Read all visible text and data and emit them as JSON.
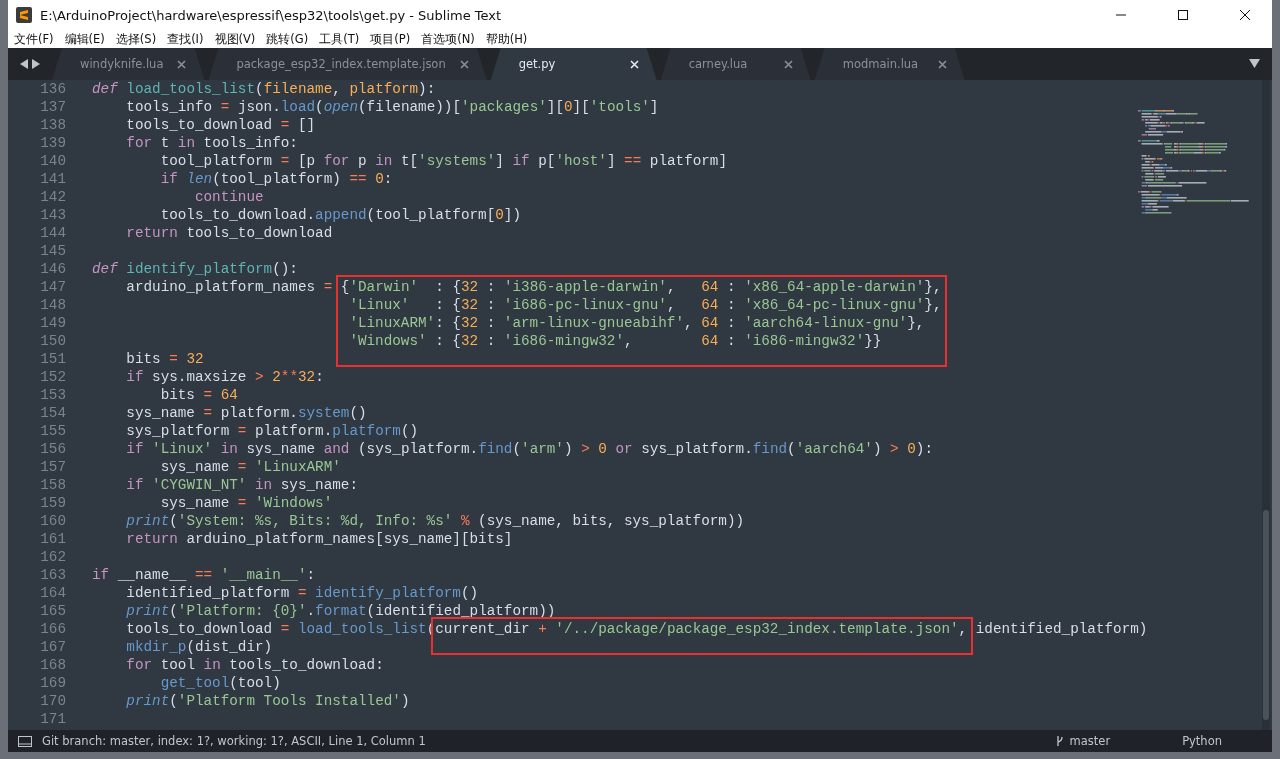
{
  "window": {
    "title": "E:\\ArduinoProject\\hardware\\espressif\\esp32\\tools\\get.py - Sublime Text"
  },
  "menu": [
    "文件(F)",
    "编辑(E)",
    "选择(S)",
    "查找(I)",
    "视图(V)",
    "跳转(G)",
    "工具(T)",
    "项目(P)",
    "首选项(N)",
    "帮助(H)"
  ],
  "tabs": [
    {
      "label": "windyknife.lua",
      "selected": false
    },
    {
      "label": "package_esp32_index.template.json",
      "selected": false
    },
    {
      "label": "get.py",
      "selected": true
    },
    {
      "label": "carney.lua",
      "selected": false
    },
    {
      "label": "modmain.lua",
      "selected": false
    }
  ],
  "editor": {
    "lines": [
      {
        "number": "136",
        "code": [
          {
            "kind": "def",
            "text": "def"
          },
          {
            "kind": "fn",
            "text": " load_tools_list"
          },
          {
            "kind": "text",
            "text": "("
          },
          {
            "kind": "param",
            "text": "filename"
          },
          {
            "kind": "text",
            "text": ", "
          },
          {
            "kind": "param",
            "text": "platform"
          },
          {
            "kind": "text",
            "text": "):"
          }
        ]
      },
      {
        "number": "137",
        "code": [
          {
            "kind": "text",
            "text": "    tools_info "
          },
          {
            "kind": "op",
            "text": "="
          },
          {
            "kind": "text",
            "text": " json."
          },
          {
            "kind": "call",
            "text": "load"
          },
          {
            "kind": "text",
            "text": "("
          },
          {
            "kind": "builtin",
            "text": "open"
          },
          {
            "kind": "text",
            "text": "(filename))["
          },
          {
            "kind": "str",
            "text": "'packages'"
          },
          {
            "kind": "text",
            "text": "]["
          },
          {
            "kind": "num",
            "text": "0"
          },
          {
            "kind": "text",
            "text": "]["
          },
          {
            "kind": "str",
            "text": "'tools'"
          },
          {
            "kind": "text",
            "text": "]"
          }
        ]
      },
      {
        "number": "138",
        "code": [
          {
            "kind": "text",
            "text": "    tools_to_download "
          },
          {
            "kind": "op",
            "text": "="
          },
          {
            "kind": "text",
            "text": " []"
          }
        ]
      },
      {
        "number": "139",
        "code": [
          {
            "kind": "kw",
            "text": "    for"
          },
          {
            "kind": "text",
            "text": " t "
          },
          {
            "kind": "kw",
            "text": "in"
          },
          {
            "kind": "text",
            "text": " tools_info:"
          }
        ]
      },
      {
        "number": "140",
        "code": [
          {
            "kind": "text",
            "text": "        tool_platform "
          },
          {
            "kind": "op",
            "text": "="
          },
          {
            "kind": "text",
            "text": " [p "
          },
          {
            "kind": "kw",
            "text": "for"
          },
          {
            "kind": "text",
            "text": " p "
          },
          {
            "kind": "kw",
            "text": "in"
          },
          {
            "kind": "text",
            "text": " t["
          },
          {
            "kind": "str",
            "text": "'systems'"
          },
          {
            "kind": "text",
            "text": "] "
          },
          {
            "kind": "kw",
            "text": "if"
          },
          {
            "kind": "text",
            "text": " p["
          },
          {
            "kind": "str",
            "text": "'host'"
          },
          {
            "kind": "text",
            "text": "] "
          },
          {
            "kind": "op",
            "text": "=="
          },
          {
            "kind": "text",
            "text": " platform]"
          }
        ]
      },
      {
        "number": "141",
        "code": [
          {
            "kind": "kw",
            "text": "        if"
          },
          {
            "kind": "builtin",
            "text": " len"
          },
          {
            "kind": "text",
            "text": "(tool_platform) "
          },
          {
            "kind": "op",
            "text": "=="
          },
          {
            "kind": "num",
            "text": " 0"
          },
          {
            "kind": "text",
            "text": ":"
          }
        ]
      },
      {
        "number": "142",
        "code": [
          {
            "kind": "kw",
            "text": "            continue"
          }
        ]
      },
      {
        "number": "143",
        "code": [
          {
            "kind": "text",
            "text": "        tools_to_download."
          },
          {
            "kind": "call",
            "text": "append"
          },
          {
            "kind": "text",
            "text": "(tool_platform["
          },
          {
            "kind": "num",
            "text": "0"
          },
          {
            "kind": "text",
            "text": "])"
          }
        ]
      },
      {
        "number": "144",
        "code": [
          {
            "kind": "kw",
            "text": "    return"
          },
          {
            "kind": "text",
            "text": " tools_to_download"
          }
        ]
      },
      {
        "number": "145"
      },
      {
        "number": "146",
        "code": [
          {
            "kind": "def",
            "text": "def"
          },
          {
            "kind": "fn",
            "text": " identify_platform"
          },
          {
            "kind": "text",
            "text": "():"
          }
        ]
      },
      {
        "number": "147",
        "code": [
          {
            "kind": "text",
            "text": "    arduino_platform_names "
          },
          {
            "kind": "op",
            "text": "="
          }
        ],
        "marked": [
          {
            "kind": "text",
            "text": " {"
          },
          {
            "kind": "str",
            "text": "'Darwin'"
          },
          {
            "kind": "text",
            "text": "  : {"
          },
          {
            "kind": "num",
            "text": "32"
          },
          {
            "kind": "text",
            "text": " : "
          },
          {
            "kind": "str",
            "text": "'i386-apple-darwin'"
          },
          {
            "kind": "text",
            "text": ",   "
          },
          {
            "kind": "num",
            "text": "64"
          },
          {
            "kind": "text",
            "text": " : "
          },
          {
            "kind": "str",
            "text": "'x86_64-apple-darwin'"
          },
          {
            "kind": "text",
            "text": "},"
          }
        ]
      },
      {
        "number": "148",
        "marked": [
          {
            "kind": "str",
            "text": "                              'Linux'"
          },
          {
            "kind": "text",
            "text": "   : {"
          },
          {
            "kind": "num",
            "text": "32"
          },
          {
            "kind": "text",
            "text": " : "
          },
          {
            "kind": "str",
            "text": "'i686-pc-linux-gnu'"
          },
          {
            "kind": "text",
            "text": ",   "
          },
          {
            "kind": "num",
            "text": "64"
          },
          {
            "kind": "text",
            "text": " : "
          },
          {
            "kind": "str",
            "text": "'x86_64-pc-linux-gnu'"
          },
          {
            "kind": "text",
            "text": "},"
          }
        ]
      },
      {
        "number": "149",
        "marked": [
          {
            "kind": "str",
            "text": "                              'LinuxARM'"
          },
          {
            "kind": "text",
            "text": ": {"
          },
          {
            "kind": "num",
            "text": "32"
          },
          {
            "kind": "text",
            "text": " : "
          },
          {
            "kind": "str",
            "text": "'arm-linux-gnueabihf'"
          },
          {
            "kind": "text",
            "text": ", "
          },
          {
            "kind": "num",
            "text": "64"
          },
          {
            "kind": "text",
            "text": " : "
          },
          {
            "kind": "str",
            "text": "'aarch64-linux-gnu'"
          },
          {
            "kind": "text",
            "text": "},"
          }
        ]
      },
      {
        "number": "150",
        "marked": [
          {
            "kind": "str",
            "text": "                              'Windows'"
          },
          {
            "kind": "text",
            "text": " : {"
          },
          {
            "kind": "num",
            "text": "32"
          },
          {
            "kind": "text",
            "text": " : "
          },
          {
            "kind": "str",
            "text": "'i686-mingw32'"
          },
          {
            "kind": "text",
            "text": ",        "
          },
          {
            "kind": "num",
            "text": "64"
          },
          {
            "kind": "text",
            "text": " : "
          },
          {
            "kind": "str",
            "text": "'i686-mingw32'"
          },
          {
            "kind": "text",
            "text": "}}"
          }
        ]
      },
      {
        "number": "151",
        "code": [
          {
            "kind": "text",
            "text": "    bits "
          },
          {
            "kind": "op",
            "text": "="
          },
          {
            "kind": "num",
            "text": " 32"
          }
        ]
      },
      {
        "number": "152",
        "code": [
          {
            "kind": "kw",
            "text": "    if"
          },
          {
            "kind": "text",
            "text": " sys.maxsize "
          },
          {
            "kind": "op",
            "text": ">"
          },
          {
            "kind": "num",
            "text": " 2"
          },
          {
            "kind": "op",
            "text": "**"
          },
          {
            "kind": "num",
            "text": "32"
          },
          {
            "kind": "text",
            "text": ":"
          }
        ]
      },
      {
        "number": "153",
        "code": [
          {
            "kind": "text",
            "text": "        bits "
          },
          {
            "kind": "op",
            "text": "="
          },
          {
            "kind": "num",
            "text": " 64"
          }
        ]
      },
      {
        "number": "154",
        "code": [
          {
            "kind": "text",
            "text": "    sys_name "
          },
          {
            "kind": "op",
            "text": "="
          },
          {
            "kind": "text",
            "text": " platform."
          },
          {
            "kind": "call",
            "text": "system"
          },
          {
            "kind": "text",
            "text": "()"
          }
        ]
      },
      {
        "number": "155",
        "code": [
          {
            "kind": "text",
            "text": "    sys_platform "
          },
          {
            "kind": "op",
            "text": "="
          },
          {
            "kind": "text",
            "text": " platform."
          },
          {
            "kind": "call",
            "text": "platform"
          },
          {
            "kind": "text",
            "text": "()"
          }
        ]
      },
      {
        "number": "156",
        "code": [
          {
            "kind": "kw",
            "text": "    if"
          },
          {
            "kind": "str",
            "text": " 'Linux'"
          },
          {
            "kind": "kw",
            "text": " in"
          },
          {
            "kind": "text",
            "text": " sys_name "
          },
          {
            "kind": "kw",
            "text": "and"
          },
          {
            "kind": "text",
            "text": " (sys_platform."
          },
          {
            "kind": "call",
            "text": "find"
          },
          {
            "kind": "text",
            "text": "("
          },
          {
            "kind": "str",
            "text": "'arm'"
          },
          {
            "kind": "text",
            "text": ") "
          },
          {
            "kind": "op",
            "text": ">"
          },
          {
            "kind": "num",
            "text": " 0"
          },
          {
            "kind": "kw",
            "text": " or"
          },
          {
            "kind": "text",
            "text": " sys_platform."
          },
          {
            "kind": "call",
            "text": "find"
          },
          {
            "kind": "text",
            "text": "("
          },
          {
            "kind": "str",
            "text": "'aarch64'"
          },
          {
            "kind": "text",
            "text": ") "
          },
          {
            "kind": "op",
            "text": ">"
          },
          {
            "kind": "num",
            "text": " 0"
          },
          {
            "kind": "text",
            "text": "):"
          }
        ]
      },
      {
        "number": "157",
        "code": [
          {
            "kind": "text",
            "text": "        sys_name "
          },
          {
            "kind": "op",
            "text": "="
          },
          {
            "kind": "str",
            "text": " 'LinuxARM'"
          }
        ]
      },
      {
        "number": "158",
        "code": [
          {
            "kind": "kw",
            "text": "    if"
          },
          {
            "kind": "str",
            "text": " 'CYGWIN_NT'"
          },
          {
            "kind": "kw",
            "text": " in"
          },
          {
            "kind": "text",
            "text": " sys_name:"
          }
        ]
      },
      {
        "number": "159",
        "code": [
          {
            "kind": "text",
            "text": "        sys_name "
          },
          {
            "kind": "op",
            "text": "="
          },
          {
            "kind": "str",
            "text": " 'Windows'"
          }
        ]
      },
      {
        "number": "160",
        "code": [
          {
            "kind": "builtin",
            "text": "    print"
          },
          {
            "kind": "text",
            "text": "("
          },
          {
            "kind": "str",
            "text": "'System: %s, Bits: %d, Info: %s'"
          },
          {
            "kind": "op",
            "text": " %"
          },
          {
            "kind": "text",
            "text": " (sys_name, bits, sys_platform))"
          }
        ]
      },
      {
        "number": "161",
        "code": [
          {
            "kind": "kw",
            "text": "    return"
          },
          {
            "kind": "text",
            "text": " arduino_platform_names[sys_name][bits]"
          }
        ]
      },
      {
        "number": "162"
      },
      {
        "number": "163",
        "code": [
          {
            "kind": "kw",
            "text": "if"
          },
          {
            "kind": "text",
            "text": " __name__ "
          },
          {
            "kind": "op",
            "text": "=="
          },
          {
            "kind": "str",
            "text": " '__main__'"
          },
          {
            "kind": "text",
            "text": ":"
          }
        ]
      },
      {
        "number": "164",
        "code": [
          {
            "kind": "text",
            "text": "    identified_platform "
          },
          {
            "kind": "op",
            "text": "="
          },
          {
            "kind": "call",
            "text": " identify_platform"
          },
          {
            "kind": "text",
            "text": "()"
          }
        ]
      },
      {
        "number": "165",
        "code": [
          {
            "kind": "builtin",
            "text": "    print"
          },
          {
            "kind": "text",
            "text": "("
          },
          {
            "kind": "str",
            "text": "'Platform: {0}'"
          },
          {
            "kind": "text",
            "text": "."
          },
          {
            "kind": "call",
            "text": "format"
          },
          {
            "kind": "text",
            "text": "(identified_platform))"
          }
        ]
      },
      {
        "number": "166",
        "code": [
          {
            "kind": "text",
            "text": "    tools_to_download "
          },
          {
            "kind": "op",
            "text": "="
          },
          {
            "kind": "call",
            "text": " load_tools_list"
          },
          {
            "kind": "text",
            "text": "("
          }
        ],
        "marked": [
          {
            "kind": "text",
            "text": "current_dir "
          },
          {
            "kind": "op",
            "text": "+"
          },
          {
            "kind": "str",
            "text": " '/../package/package_esp32_index.template.json'"
          },
          {
            "kind": "text",
            "text": ","
          }
        ],
        "rest": [
          {
            "kind": "text",
            "text": " identified_platform)"
          }
        ]
      },
      {
        "number": "167",
        "code": [
          {
            "kind": "call",
            "text": "    mkdir_p"
          },
          {
            "kind": "text",
            "text": "(dist_dir)"
          }
        ]
      },
      {
        "number": "168",
        "code": [
          {
            "kind": "kw",
            "text": "    for"
          },
          {
            "kind": "text",
            "text": " tool "
          },
          {
            "kind": "kw",
            "text": "in"
          },
          {
            "kind": "text",
            "text": " tools_to_download:"
          }
        ]
      },
      {
        "number": "169",
        "code": [
          {
            "kind": "call",
            "text": "        get_tool"
          },
          {
            "kind": "text",
            "text": "(tool)"
          }
        ]
      },
      {
        "number": "170",
        "code": [
          {
            "kind": "builtin",
            "text": "    print"
          },
          {
            "kind": "text",
            "text": "("
          },
          {
            "kind": "str",
            "text": "'Platform Tools Installed'"
          },
          {
            "kind": "text",
            "text": ")"
          }
        ]
      },
      {
        "number": "171"
      }
    ]
  },
  "status_bar": {
    "text": "Git branch: master, index: 1?, working: 1?, ASCII, Line 1, Column 1",
    "branch": "master",
    "syntax": "Python"
  }
}
